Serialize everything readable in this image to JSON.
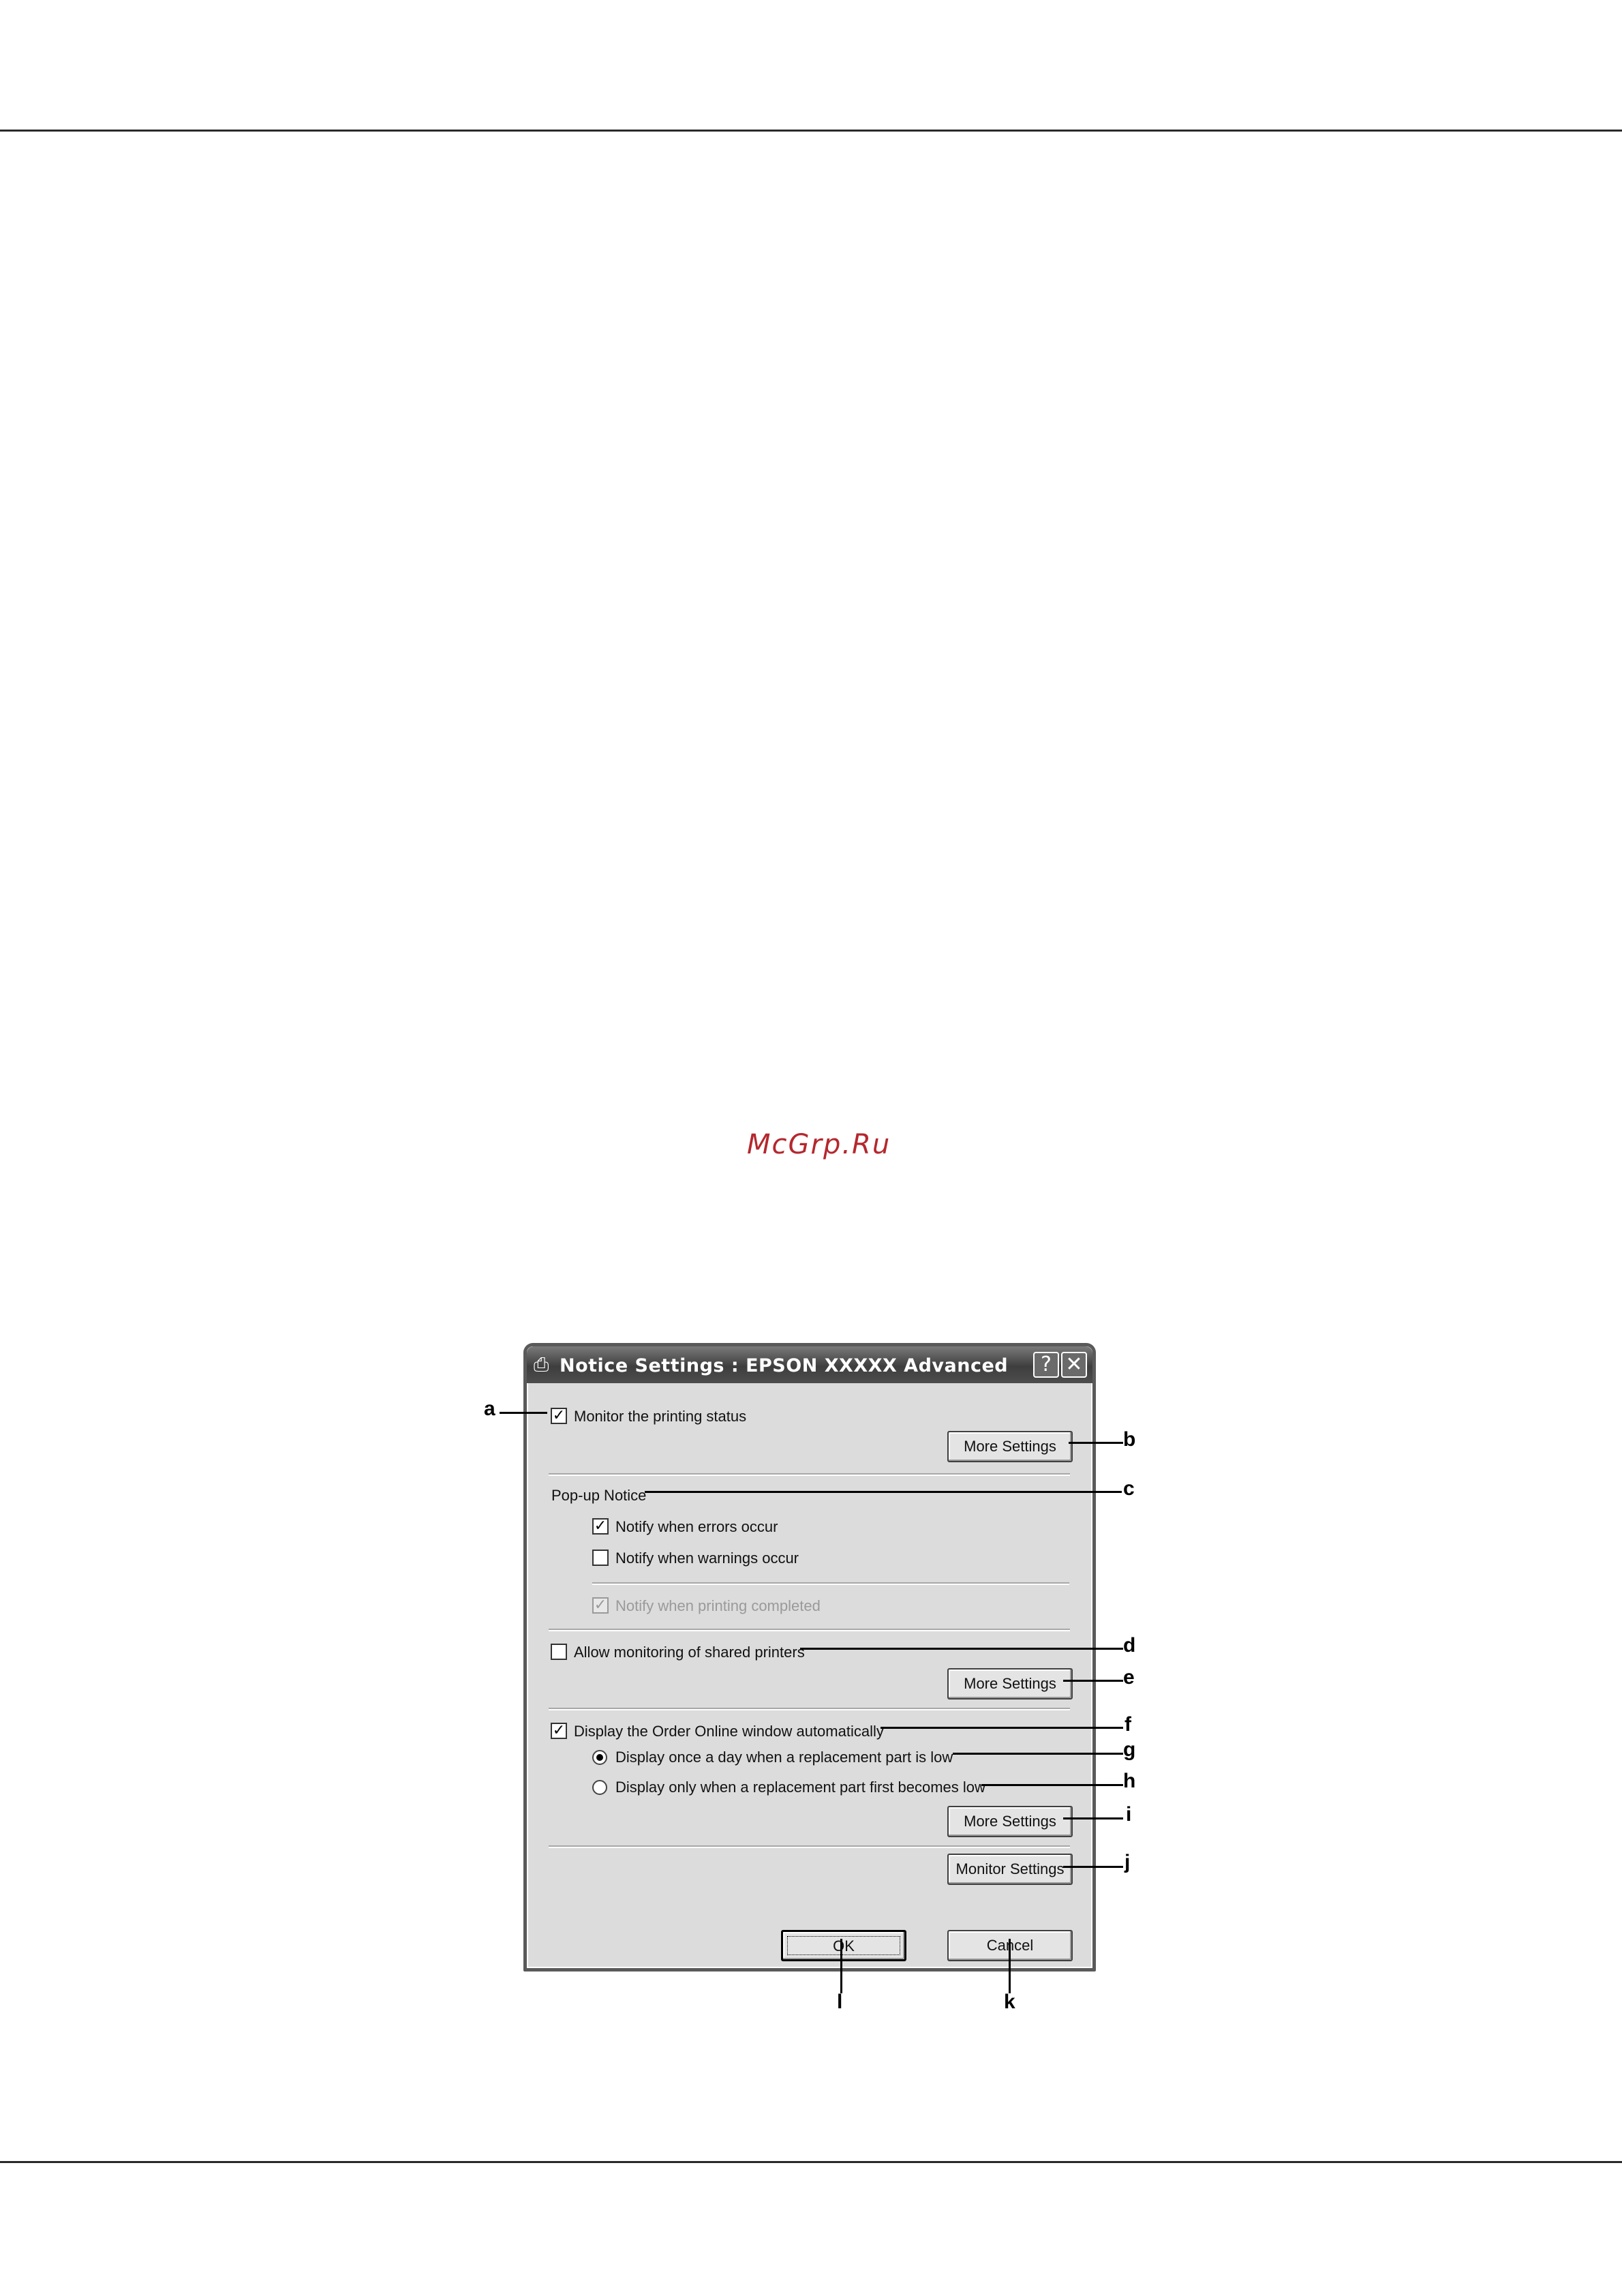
{
  "dialog": {
    "title": "Notice Settings : EPSON XXXXX Advanced",
    "help_glyph": "?",
    "close_glyph": "✕",
    "monitor_status_label": "Monitor the printing status",
    "monitor_status_checked": true,
    "more_settings_label": "More Settings",
    "popup_notice_label": "Pop-up Notice",
    "notify_errors_label": "Notify when errors occur",
    "notify_errors_checked": true,
    "notify_warnings_label": "Notify when warnings occur",
    "notify_warnings_checked": false,
    "notify_completed_label": "Notify when printing completed",
    "notify_completed_checked": true,
    "allow_shared_label": "Allow monitoring of shared printers",
    "allow_shared_checked": false,
    "order_online_label": "Display the Order Online window automatically",
    "order_online_checked": true,
    "once_a_day_label": "Display once a day when a replacement part is low",
    "first_low_label": "Display only when a replacement part first becomes low",
    "monitor_settings_label": "Monitor Settings",
    "ok_label": "OK",
    "cancel_label": "Cancel"
  },
  "callouts": {
    "a": "a",
    "b": "b",
    "c": "c",
    "d": "d",
    "e": "e",
    "f": "f",
    "g": "g",
    "h": "h",
    "i": "i",
    "j": "j",
    "k": "k",
    "l": "l"
  },
  "watermark": "McGrp.Ru",
  "icons": {
    "title_icon": "printer-monitor-icon",
    "check_glyph": "✓"
  },
  "colors": {
    "watermark": "#b4282e",
    "titlebar": "#4d4d4d",
    "dialog_bg": "#dcdcdc"
  }
}
